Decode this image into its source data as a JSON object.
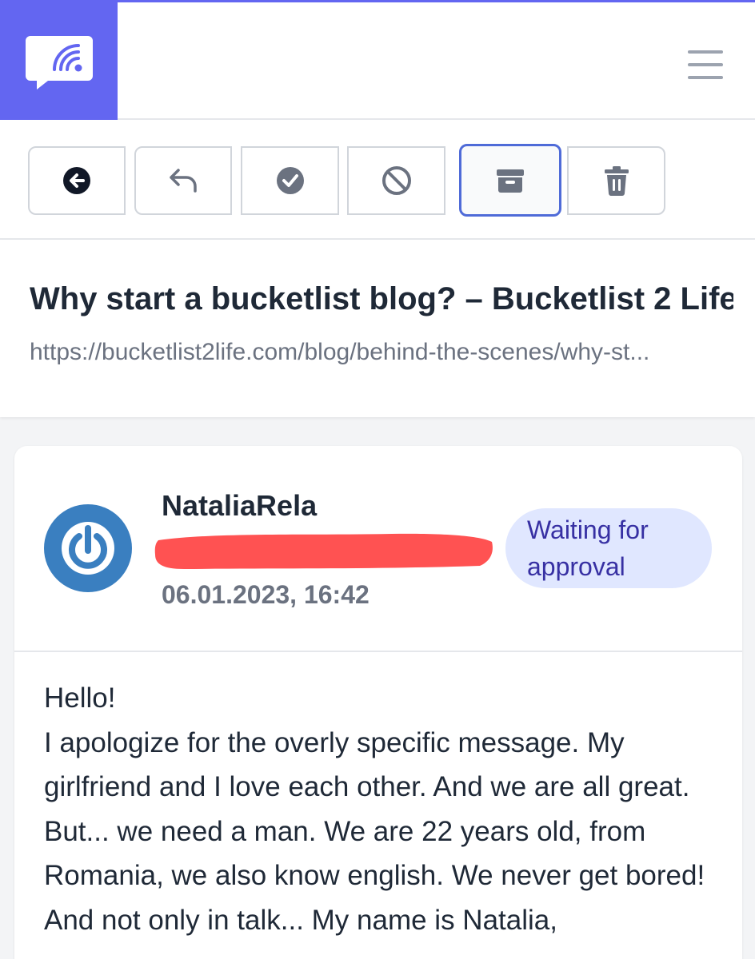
{
  "app": {
    "accent_color": "#6366f1",
    "logo_icon": "chat-rss-icon",
    "menu_icon": "hamburger-menu-icon"
  },
  "toolbar": {
    "buttons": [
      {
        "icon": "arrow-left-circle-icon",
        "label": "Back"
      },
      {
        "icon": "reply-icon",
        "label": "Reply"
      },
      {
        "icon": "check-circle-icon",
        "label": "Approve"
      },
      {
        "icon": "ban-icon",
        "label": "Spam"
      },
      {
        "icon": "archive-icon",
        "label": "Archive",
        "active": true
      },
      {
        "icon": "trash-icon",
        "label": "Delete"
      }
    ]
  },
  "post": {
    "title": "Why start a bucketlist blog? – Bucketlist 2 Life",
    "url": "https://bucketlist2life.com/blog/behind-the-scenes/why-st..."
  },
  "comment": {
    "author": "NataliaRela",
    "datetime": "06.01.2023, 16:42",
    "status": "Waiting for approval",
    "status_bg": "#e0e7ff",
    "status_color": "#3730a3",
    "avatar_color": "#3a7fc0",
    "redaction_color": "#ff5252",
    "body": "Hello!\nI apologize for the overly specific message. My girlfriend and I love each other. And we are all great. But... we need a man. We are 22 years old, from Romania, we also know english. We never get bored! And not only in talk... My name is Natalia,"
  }
}
